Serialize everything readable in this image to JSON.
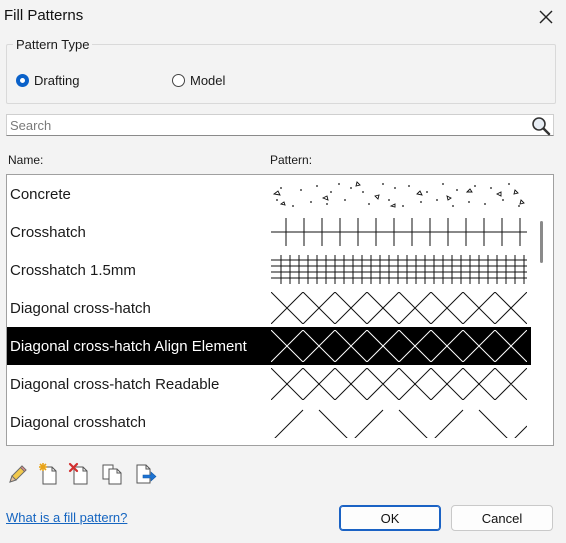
{
  "window": {
    "title": "Fill Patterns"
  },
  "pattern_type": {
    "legend": "Pattern Type",
    "options": [
      {
        "label": "Drafting",
        "selected": true
      },
      {
        "label": "Model",
        "selected": false
      }
    ]
  },
  "search": {
    "placeholder": "Search",
    "value": ""
  },
  "columns": {
    "name": "Name:",
    "pattern": "Pattern:"
  },
  "patterns": [
    {
      "name": "Concrete",
      "pattern_icon": "concrete-pattern",
      "selected": false
    },
    {
      "name": "Crosshatch",
      "pattern_icon": "crosshatch-pattern",
      "selected": false
    },
    {
      "name": "Crosshatch 1.5mm",
      "pattern_icon": "crosshatch-fine-pattern",
      "selected": false
    },
    {
      "name": "Diagonal cross-hatch",
      "pattern_icon": "diagonal-cross-hatch-pattern",
      "selected": false
    },
    {
      "name": "Diagonal cross-hatch Align Element",
      "pattern_icon": "diagonal-cross-hatch-pattern",
      "selected": true
    },
    {
      "name": "Diagonal cross-hatch Readable",
      "pattern_icon": "diagonal-cross-hatch-pattern",
      "selected": false
    },
    {
      "name": "Diagonal crosshatch",
      "pattern_icon": "diagonal-crosshatch-wide-pattern",
      "selected": false
    }
  ],
  "toolbar": {
    "icons": [
      "edit-pencil-icon",
      "new-pattern-icon",
      "delete-pattern-icon",
      "duplicate-pattern-icon",
      "import-pattern-icon"
    ]
  },
  "help_link": "What is a fill pattern?",
  "buttons": {
    "ok": "OK",
    "cancel": "Cancel"
  },
  "colors": {
    "accent": "#0a61c9",
    "selection": "#000000",
    "link": "#1565c0"
  }
}
